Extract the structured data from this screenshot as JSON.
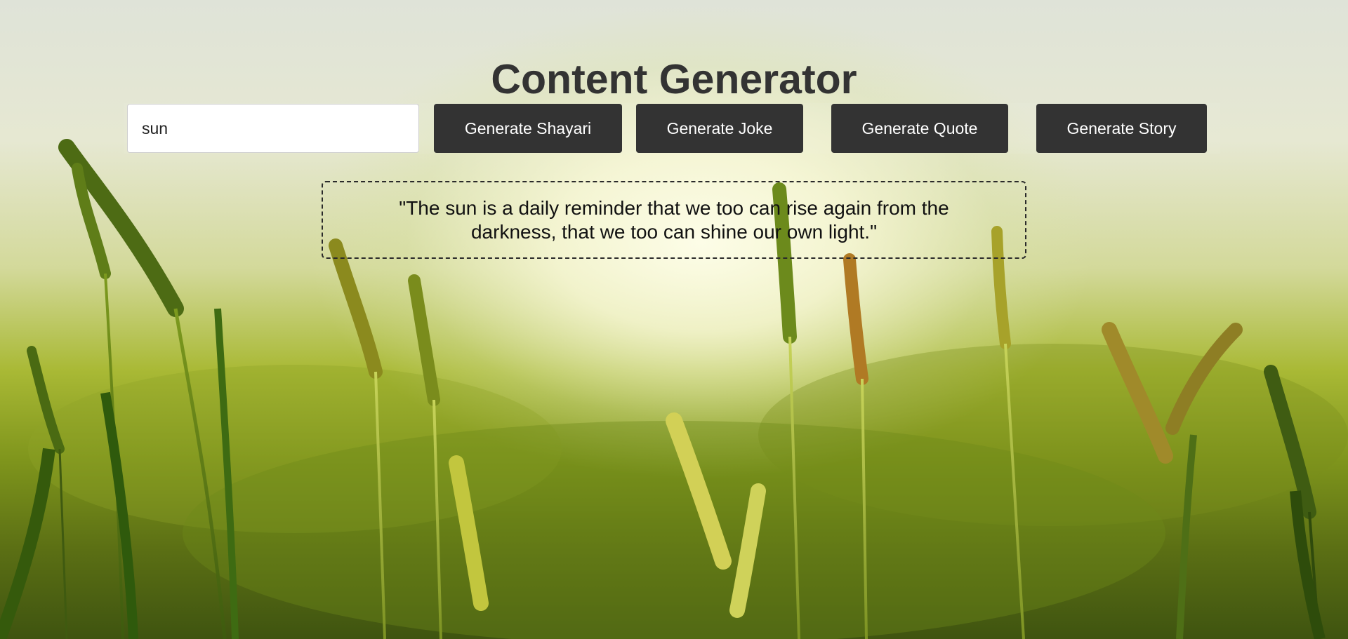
{
  "header": {
    "title": "Content Generator"
  },
  "generator": {
    "input_value": "sun",
    "buttons": {
      "shayari": "Generate Shayari",
      "joke": "Generate Joke",
      "quote": "Generate Quote",
      "story": "Generate Story"
    }
  },
  "output": {
    "text": "\"The sun is a daily reminder that we too can rise again from the darkness, that we too can shine our own light.\""
  },
  "theme": {
    "button_bg": "#333333",
    "button_text": "#ffffff",
    "title_color": "#333333"
  }
}
